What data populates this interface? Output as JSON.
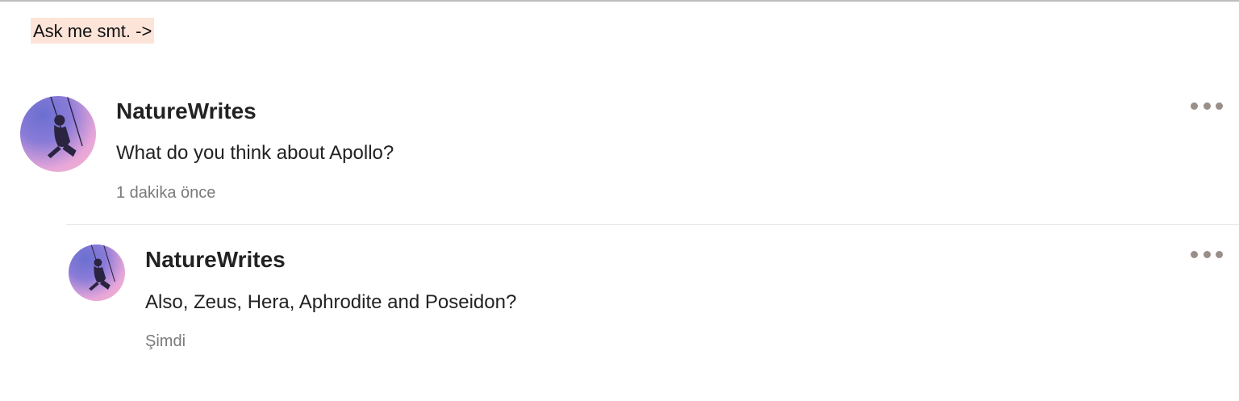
{
  "prompt": {
    "text": "Ask me smt. ->"
  },
  "comments": [
    {
      "username": "NatureWrites",
      "message": "What do you think about Apollo?",
      "timestamp": "1 dakika önce",
      "avatar_icon": "avatar-swing-girl"
    }
  ],
  "replies": [
    {
      "username": "NatureWrites",
      "message": "Also, Zeus, Hera, Aphrodite and Poseidon?",
      "timestamp": "Şimdi",
      "avatar_icon": "avatar-swing-girl"
    }
  ],
  "more_icon": "more-options-icon",
  "colors": {
    "prompt_highlight": "#fde4d9",
    "timestamp_gray": "#7a7a7a",
    "dots_gray": "#9a8f88"
  }
}
